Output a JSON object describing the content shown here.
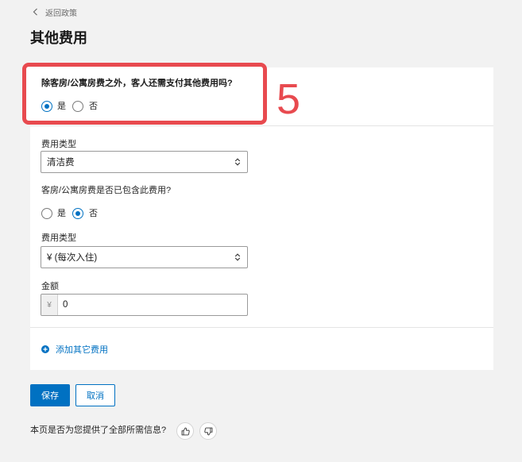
{
  "colors": {
    "accent": "#0071c2",
    "annotation": "#e84a4f",
    "page_background": "#f2f2f2",
    "card_background": "#ffffff"
  },
  "nav": {
    "back_label": "返回政策",
    "back_icon": "chevron-left-icon"
  },
  "page": {
    "title": "其他费用"
  },
  "question": {
    "label": "除客房/公寓房费之外，客人还需支付其他费用吗?",
    "options": [
      {
        "label": "是",
        "selected": true
      },
      {
        "label": "否",
        "selected": false
      }
    ]
  },
  "annotation": {
    "label": "5"
  },
  "fee": {
    "fee_type": {
      "label": "费用类型",
      "value": "清洁费",
      "icon": "select-updown-icon"
    },
    "included": {
      "label": "客房/公寓房费是否已包含此费用?",
      "options": [
        {
          "label": "是",
          "selected": false
        },
        {
          "label": "否",
          "selected": true
        }
      ]
    },
    "charge_type": {
      "label": "费用类型",
      "value": "¥ (每次入住)",
      "icon": "select-updown-icon"
    },
    "amount": {
      "label": "金额",
      "currency": "¥",
      "value": "0"
    }
  },
  "add_fee": {
    "label": "添加其它费用",
    "icon": "plus-circle-icon"
  },
  "actions": {
    "save_label": "保存",
    "cancel_label": "取消"
  },
  "feedback": {
    "question": "本页是否为您提供了全部所需信息?",
    "icons": [
      "thumbs-up-icon",
      "thumbs-down-icon"
    ]
  }
}
